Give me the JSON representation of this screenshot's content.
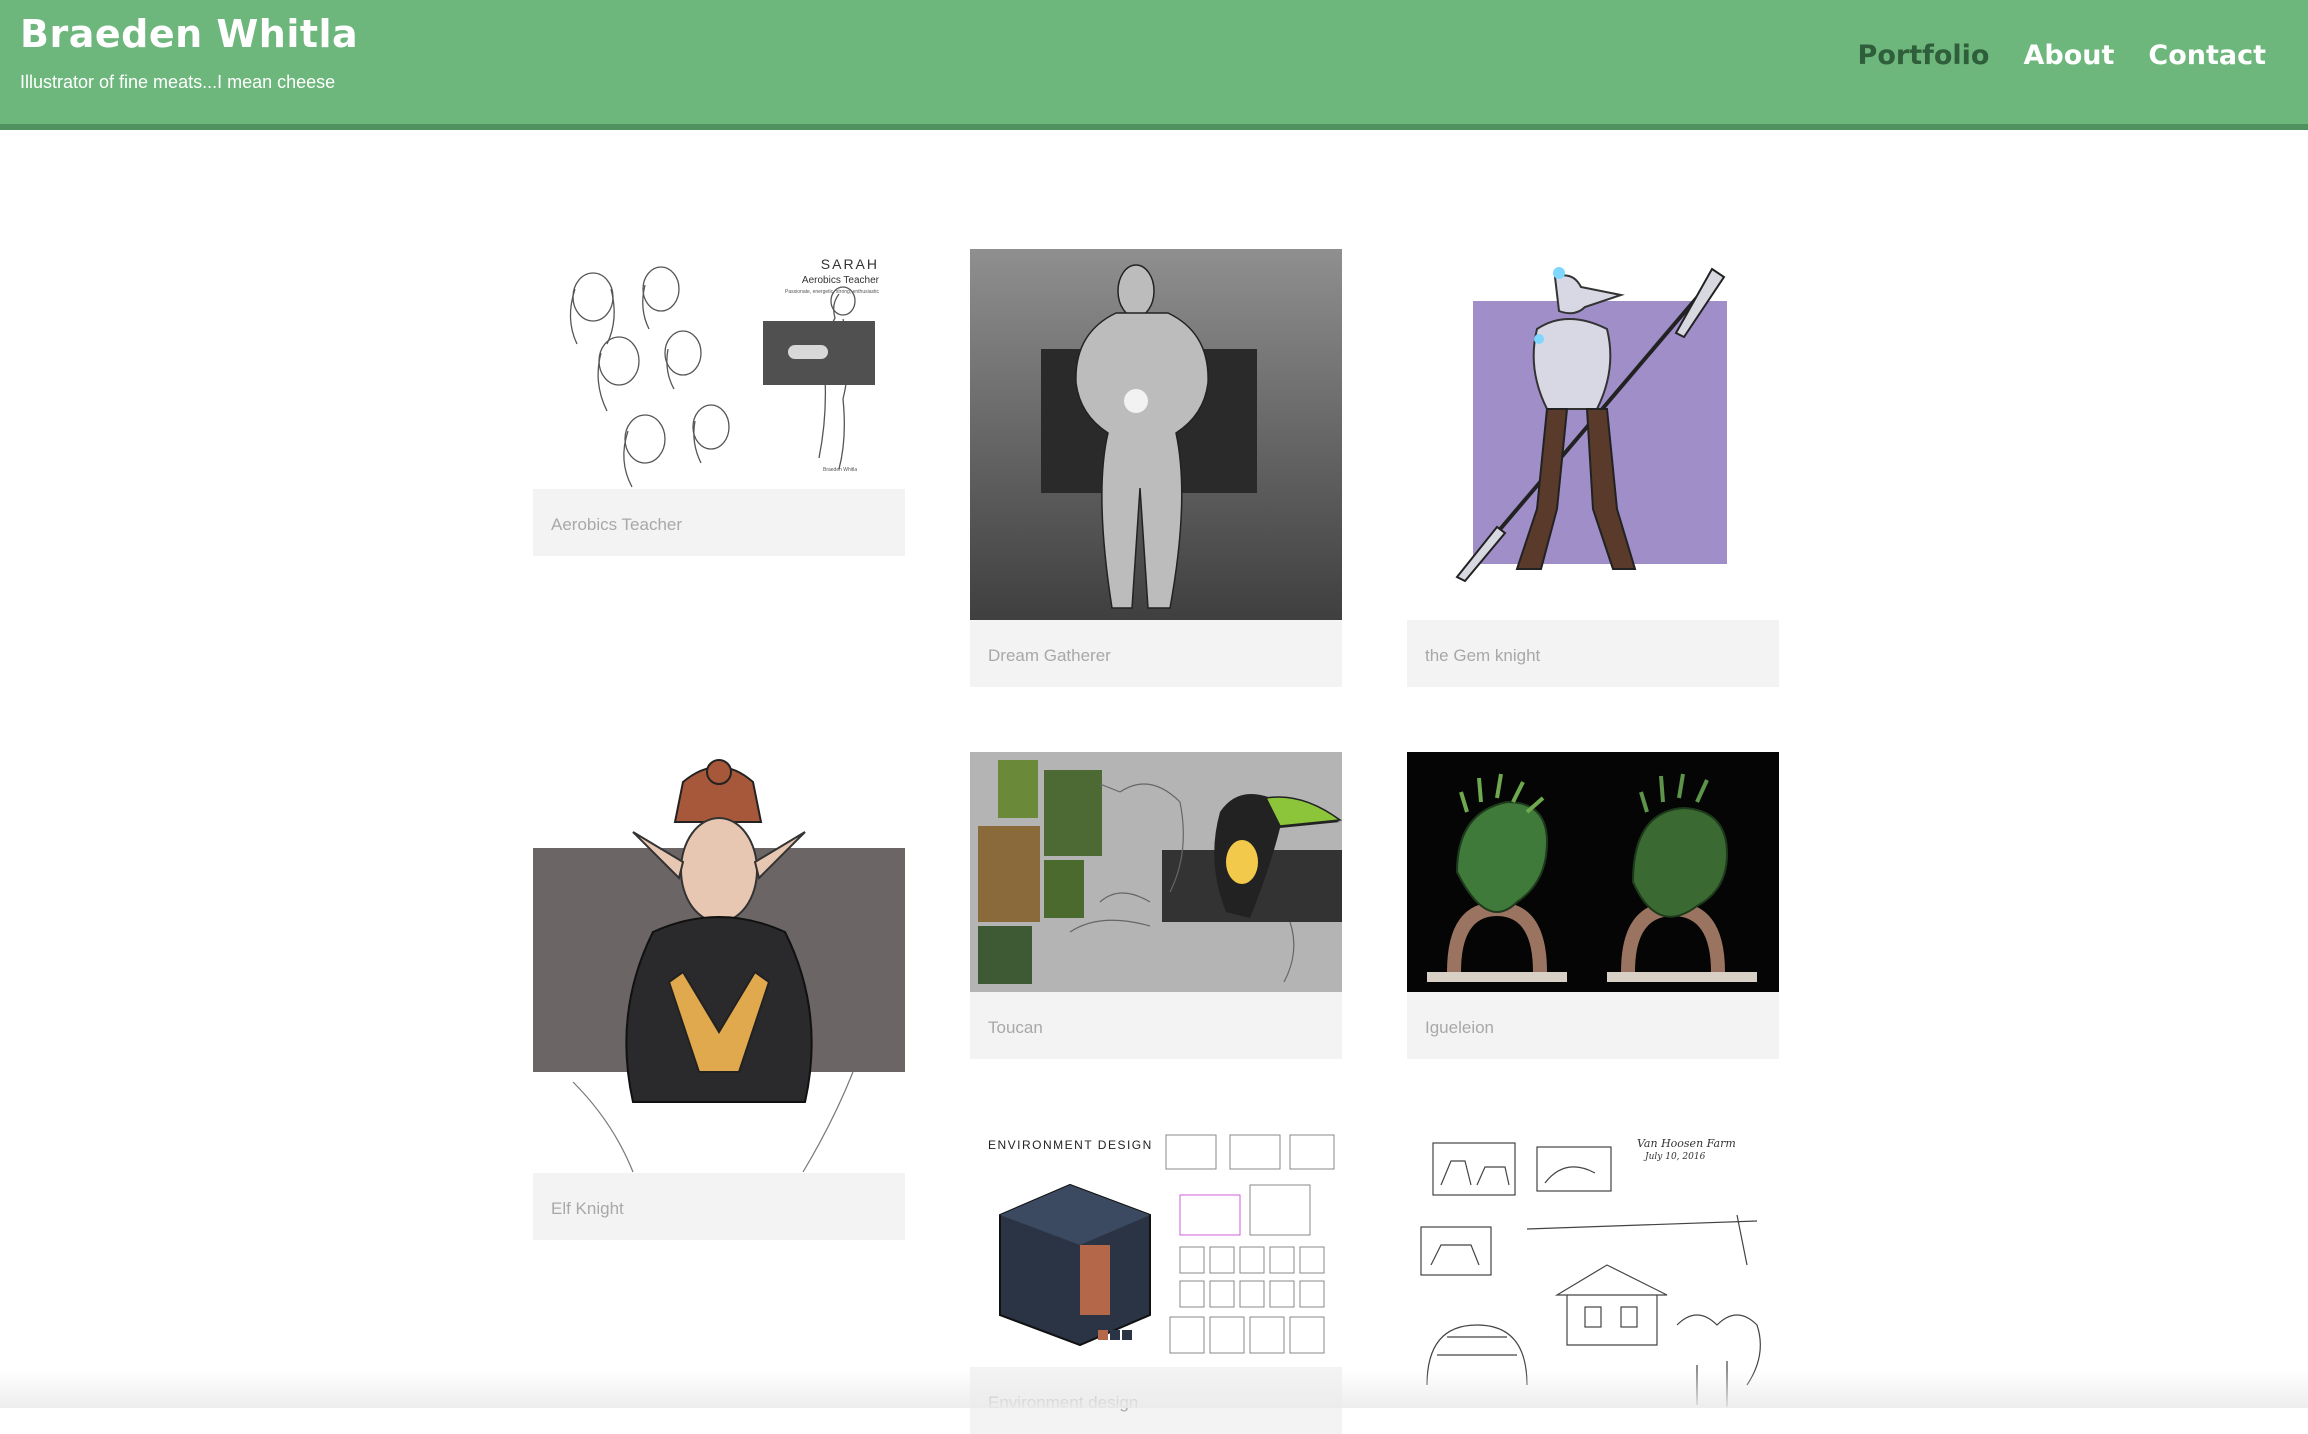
{
  "header": {
    "title": "Braeden Whitla",
    "tagline": "Illustrator of fine meats...I mean cheese",
    "nav": [
      {
        "label": "Portfolio",
        "active": true
      },
      {
        "label": "About",
        "active": false
      },
      {
        "label": "Contact",
        "active": false
      }
    ]
  },
  "colors": {
    "header_bg": "#6db67c",
    "header_border": "#4f9260",
    "nav_active": "#2f5e3a",
    "caption_bg": "#f3f3f3",
    "caption_text": "#a8a8a8"
  },
  "gallery": {
    "items": [
      {
        "caption": "Aerobics Teacher",
        "art_text": [
          "SARAH",
          "Aerobics Teacher",
          "Passionate, energetic, strong, enthusiastic",
          "Braeden Whitla"
        ]
      },
      {
        "caption": "Dream Gatherer"
      },
      {
        "caption": "the Gem knight"
      },
      {
        "caption": "Elf Knight"
      },
      {
        "caption": "Toucan"
      },
      {
        "caption": "Igueleion"
      },
      {
        "caption": "Environment design",
        "art_text": [
          "ENVIRONMENT DESIGN"
        ]
      },
      {
        "caption": "",
        "art_text": [
          "Van Hoosen Farm",
          "July 10, 2016"
        ]
      }
    ]
  }
}
